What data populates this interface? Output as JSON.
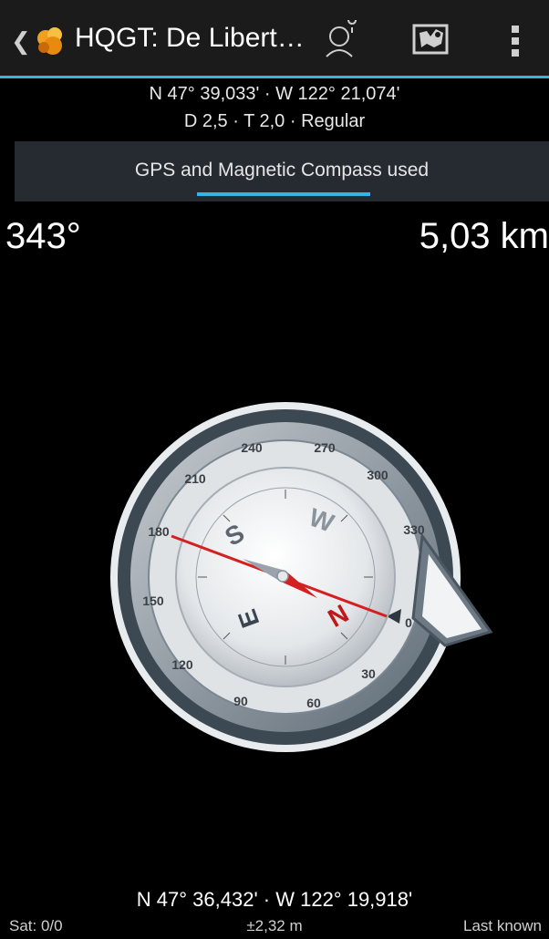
{
  "appbar": {
    "title": "HQGT: De Libert…",
    "back_icon": "chevron-left-icon",
    "logo_icon": "geocache-logo-icon",
    "actions": [
      "navigate-person-icon",
      "map-icon",
      "overflow-menu-icon"
    ]
  },
  "target": {
    "coords": "N 47° 39,033' · W 122° 21,074'",
    "info": "D 2,5 · T 2,0 · Regular"
  },
  "sensor": {
    "label": "GPS and Magnetic Compass used"
  },
  "direction": {
    "bearing": "343°",
    "distance": "5,03 km"
  },
  "compass": {
    "outer_ticks": [
      "240",
      "270",
      "300",
      "330",
      "0",
      "30",
      "60",
      "90",
      "120",
      "150",
      "180",
      "210"
    ],
    "cardinals": [
      "S",
      "W",
      "N",
      "E"
    ],
    "needle_color": "#d42020"
  },
  "footer": {
    "coords": "N 47° 36,432' · W 122° 19,918'",
    "satellites": "Sat: 0/0",
    "accuracy": "±2,32 m",
    "provider": "Last known"
  },
  "colors": {
    "accent": "#33b5e5",
    "background": "#000000",
    "bar": "#262b31"
  }
}
